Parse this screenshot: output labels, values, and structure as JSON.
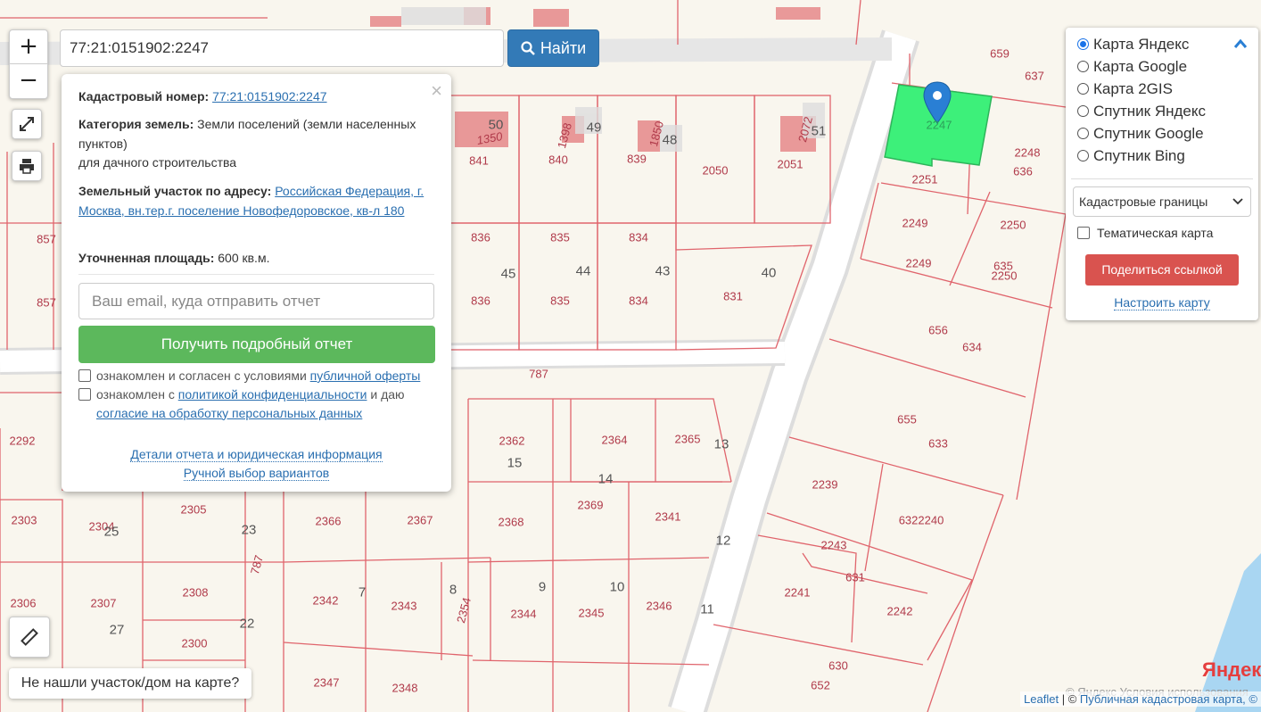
{
  "search": {
    "value": "77:21:0151902:2247",
    "button_label": "Найти"
  },
  "zoom": {
    "plus": "+",
    "minus": "−"
  },
  "popup": {
    "close": "×",
    "cadastral_label": "Кадастровый номер:",
    "cadastral_value": "77:21:0151902:2247",
    "category_label": "Категория земель:",
    "category_value": "Земли поселений (земли населенных пунктов)",
    "use_value": "для дачного строительства",
    "address_label": "Земельный участок по адресу:",
    "address_value": "Российская Федерация, г. Москва, вн.тер.г. поселение Новофедоровское, кв-л 180",
    "area_label": "Уточненная площадь:",
    "area_value": "600 кв.м.",
    "email_placeholder": "Ваш email, куда отправить отчет",
    "report_button": "Получить подробный отчет",
    "check1_text": "ознакомлен и согласен с условиями",
    "check1_link": "публичной оферты",
    "check2_text": "ознакомлен с",
    "check2_link": "политикой конфиденциальности",
    "check2_mid": "и даю",
    "check2_link2": "согласие на обработку персональных данных",
    "details_link": "Детали отчета и юридическая информация",
    "manual_link": "Ручной выбор вариантов"
  },
  "layers": {
    "options": [
      "Карта Яндекс",
      "Карта Google",
      "Карта 2GIS",
      "Спутник Яндекс",
      "Спутник Google",
      "Спутник Bing"
    ],
    "selected": "Карта Яндекс",
    "overlay_select": "Кадастровые границы",
    "thematic_label": "Тематическая карта",
    "share_button": "Поделиться ссылкой",
    "configure_link": "Настроить карту"
  },
  "not_found_button": "Не нашли участок/дом на карте?",
  "attribution": {
    "leaflet": "Leaflet",
    "sep": " | © ",
    "pkk": "Публичная кадастровая карта, ©",
    "yandex_terms": "© Яндекс  Условия использования"
  },
  "yandex_logo": "Яндекс",
  "colors": {
    "selected_plot": "#3df07a",
    "boundary": "#e0646c",
    "marker": "#2a7fd4",
    "search_button": "#337ab7",
    "report_button": "#5cb85c",
    "share_button": "#d9534f"
  },
  "map": {
    "plot_labels": [
      "659",
      "637",
      "2247",
      "2248",
      "636",
      "2251",
      "2249",
      "2250",
      "2249",
      "635",
      "2250",
      "656",
      "634",
      "655",
      "633",
      "2239",
      "6322240",
      "2243",
      "631",
      "2241",
      "2242",
      "630",
      "652",
      "1350",
      "841",
      "1398",
      "840",
      "1850",
      "839",
      "2050",
      "2072",
      "2051",
      "857",
      "836",
      "835",
      "834",
      "831",
      "857",
      "836",
      "835",
      "834",
      "787",
      "2292",
      "2362",
      "2364",
      "2365",
      "2303",
      "2304",
      "2305",
      "2366",
      "2367",
      "2368",
      "2369",
      "2341",
      "2306",
      "2307",
      "2308",
      "2300",
      "2342",
      "2343",
      "2354",
      "2344",
      "2345",
      "2346",
      "2347",
      "2348",
      "787"
    ],
    "block_labels": [
      "50",
      "49",
      "48",
      "51",
      "45",
      "44",
      "43",
      "40",
      "15",
      "14",
      "13",
      "23",
      "12",
      "25",
      "7",
      "8",
      "9",
      "10",
      "11",
      "27",
      "22"
    ]
  }
}
